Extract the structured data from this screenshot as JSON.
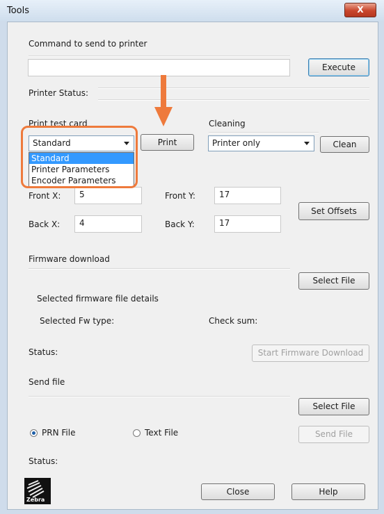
{
  "window": {
    "title": "Tools",
    "close_glyph": "X"
  },
  "command": {
    "label": "Command to send to printer",
    "value": "",
    "execute_label": "Execute",
    "status_label": "Printer Status:"
  },
  "print_test": {
    "label": "Print test card",
    "selected": "Standard",
    "options": [
      "Standard",
      "Printer Parameters",
      "Encoder Parameters"
    ],
    "print_label": "Print"
  },
  "cleaning": {
    "label": "Cleaning",
    "selected": "Printer only",
    "clean_label": "Clean"
  },
  "offsets": {
    "front_x_label": "Front X:",
    "front_x_value": "5",
    "front_y_label": "Front Y:",
    "front_y_value": "17",
    "back_x_label": "Back X:",
    "back_x_value": "4",
    "back_y_label": "Back Y:",
    "back_y_value": "17",
    "set_label": "Set Offsets"
  },
  "firmware": {
    "label": "Firmware download",
    "select_label": "Select File",
    "details_label": "Selected firmware file details",
    "fw_type_label": "Selected Fw type:",
    "checksum_label": "Check sum:",
    "status_label": "Status:",
    "start_label": "Start Firmware Download"
  },
  "send_file": {
    "label": "Send file",
    "select_label": "Select File",
    "prn_label": "PRN File",
    "text_label": "Text File",
    "send_label": "Send File",
    "status_label": "Status:",
    "prn_selected": true
  },
  "footer": {
    "logo_text": "Zebra",
    "close_label": "Close",
    "help_label": "Help"
  },
  "annotation": {
    "highlight_color": "#ee7a3c",
    "arrow_color": "#ee7a3c"
  }
}
